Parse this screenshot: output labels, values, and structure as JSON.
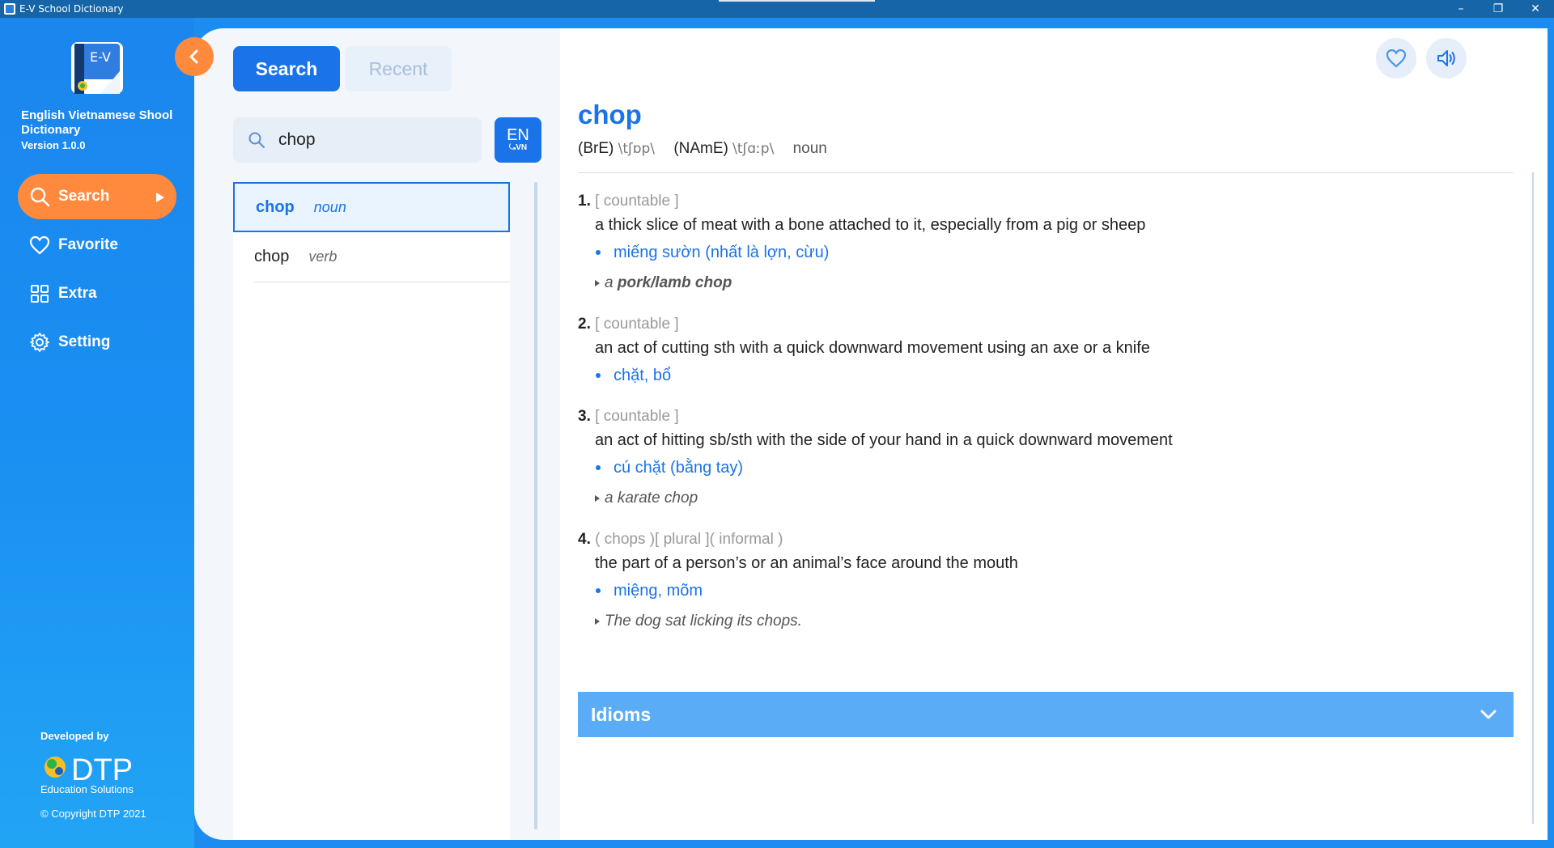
{
  "window": {
    "title": "E-V School Dictionary",
    "controls": {
      "minimize": "–",
      "restore": "❐",
      "close": "✕"
    }
  },
  "sidebar": {
    "logo_text": "E-V",
    "app_name": "English Vietnamese Shool Dictionary",
    "version": "Version 1.0.0",
    "nav": [
      {
        "label": "Search",
        "icon": "search-icon",
        "active": true
      },
      {
        "label": "Favorite",
        "icon": "heart-icon",
        "active": false
      },
      {
        "label": "Extra",
        "icon": "grid-icon",
        "active": false
      },
      {
        "label": "Setting",
        "icon": "gear-icon",
        "active": false
      }
    ],
    "developed_by": "Developed by",
    "dev_logo_text": "DTP",
    "dev_logo_sub": "Education Solutions",
    "copyright": "© Copyright DTP 2021"
  },
  "tabs": {
    "search": "Search",
    "recent": "Recent"
  },
  "search": {
    "value": "chop",
    "placeholder": ""
  },
  "lang_toggle": {
    "top": "EN",
    "bottom": "VN"
  },
  "results": [
    {
      "word": "chop",
      "pos": "noun",
      "selected": true
    },
    {
      "word": "chop",
      "pos": "verb",
      "selected": false
    }
  ],
  "entry": {
    "headword": "chop",
    "bre_label": "(BrE)",
    "bre_ipa": "\\tʃɒp\\",
    "name_label": "(NAmE)",
    "name_ipa": "\\tʃɑːp\\",
    "pos": "noun",
    "senses": [
      {
        "num": "1.",
        "labels": "[ countable ]",
        "definition": "a thick slice of meat with a bone attached to it, especially from a pig or sheep",
        "translation": "miếng sườn (nhất là lợn, cừu)",
        "example_prefix": "a ",
        "example_bold": "pork/lamb chop"
      },
      {
        "num": "2.",
        "labels": "[ countable ]",
        "definition": "an act of cutting sth with a quick downward movement using an axe or a knife",
        "translation": "chặt, bổ"
      },
      {
        "num": "3.",
        "labels": "[ countable ]",
        "definition": "an act of hitting sb/sth with the side of your hand in a quick downward movement",
        "translation": "cú chặt (bằng tay)",
        "example": "a karate chop"
      },
      {
        "num": "4.",
        "labels": "( chops )[ plural ]( informal )",
        "definition": "the part of a person’s or an animal’s face around the mouth",
        "translation": "miệng, mõm",
        "example": "The dog sat licking its chops."
      }
    ],
    "idioms_label": "Idioms"
  },
  "colors": {
    "primary": "#1a73e8",
    "accent": "#ff8a3d",
    "idioms_bar": "#5aacf6",
    "sidebar": "#1b86ee"
  }
}
